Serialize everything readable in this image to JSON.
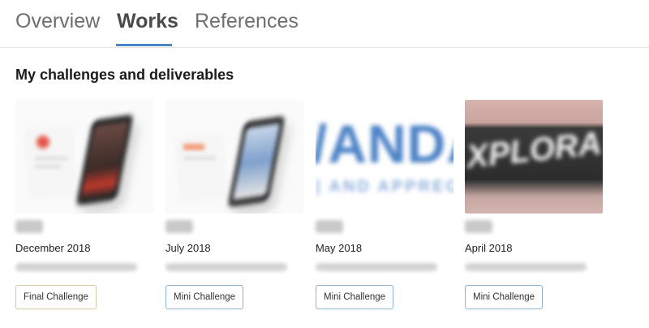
{
  "tabs": [
    {
      "label": "Overview"
    },
    {
      "label": "Works"
    },
    {
      "label": "References"
    }
  ],
  "active_tab": "Works",
  "accent_color": "#4a87c7",
  "section_title": "My challenges and deliverables",
  "cards": [
    {
      "date": "December 2018",
      "button": "Final Challenge",
      "thumb": "phone-mockup-red"
    },
    {
      "date": "July 2018",
      "button": "Mini Challenge",
      "thumb": "phone-mockup-blue"
    },
    {
      "date": "May 2018",
      "button": "Mini Challenge",
      "thumb": "wordmark-blue"
    },
    {
      "date": "April 2018",
      "button": "Mini Challenge",
      "thumb": "photo-lettering"
    }
  ]
}
